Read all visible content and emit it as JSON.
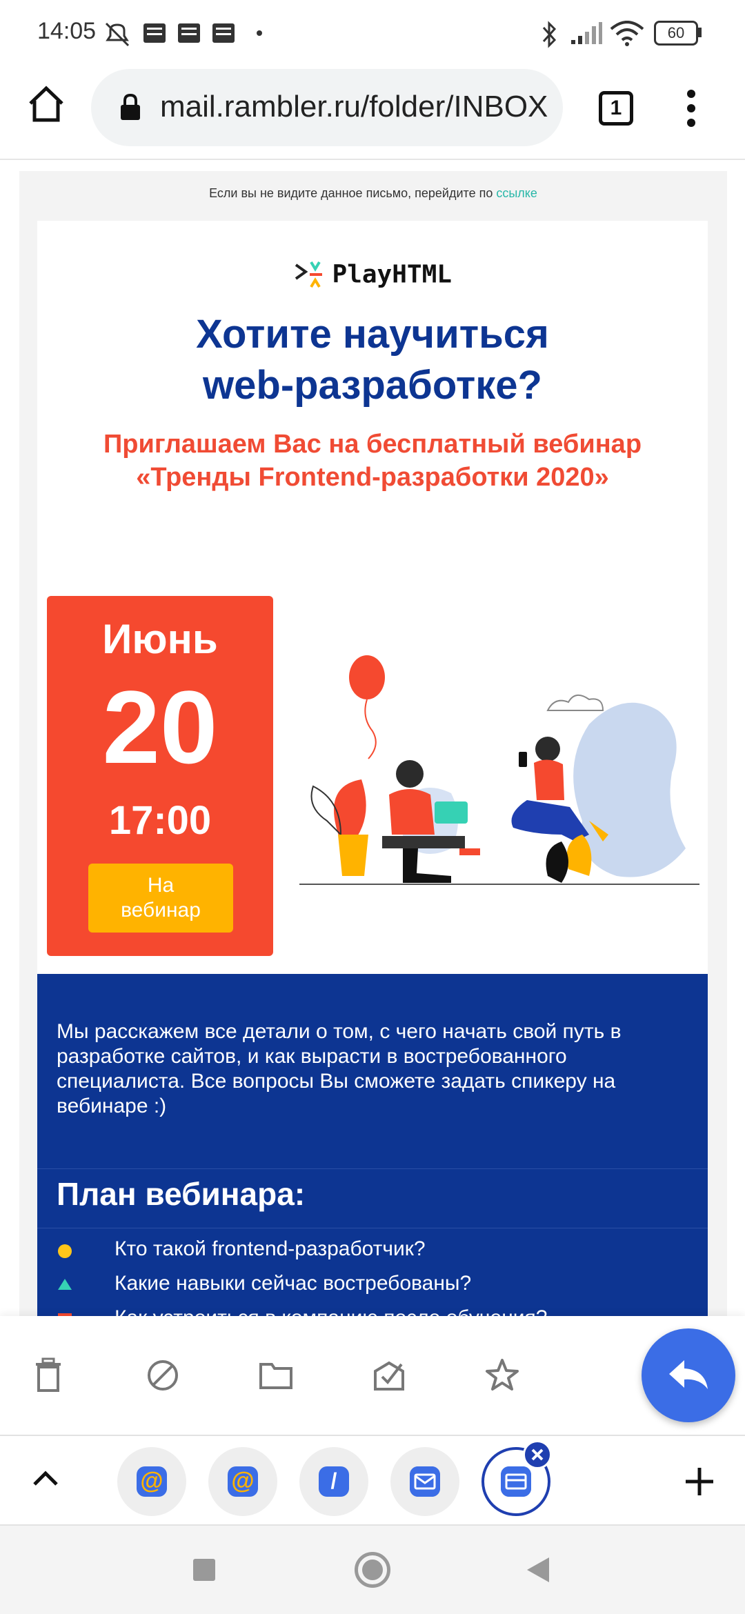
{
  "status_bar": {
    "time": "14:05",
    "battery": "60"
  },
  "browser": {
    "url": "mail.rambler.ru/folder/INBOX",
    "tab_count": "1"
  },
  "email": {
    "preheader_text": "Если вы не видите данное письмо, перейдите по ",
    "preheader_link": "ссылке",
    "logo_text": "PlayHTML",
    "headline_line1": "Хотите научиться",
    "headline_line2": "web-разработке?",
    "subhead_line1": "Приглашаем Вас на бесплатный вебинар",
    "subhead_line2": "«Тренды Frontend-разработки 2020»",
    "date": {
      "month": "Июнь",
      "day": "20",
      "time": "17:00",
      "button_line1": "На",
      "button_line2": "вебинар"
    },
    "intro_text": "Мы расскажем все детали о том, с чего начать свой путь в разработке сайтов, и как вырасти в востребованного специалиста. Все вопросы Вы сможете задать спикеру на вебинаре :)",
    "plan_title": "План вебинара:",
    "plan_items": [
      "Кто такой frontend-разработчик?",
      "Какие навыки сейчас востребованы?",
      "Как устроиться в компанию после обучения?"
    ]
  },
  "toolbar": {
    "icons": [
      "trash-icon",
      "block-icon",
      "folder-icon",
      "mark-read-icon",
      "star-icon",
      "reply-icon"
    ]
  },
  "tabs": {
    "icons": [
      "chevron-up-icon",
      "at-icon",
      "at-icon",
      "slash-icon",
      "mail-icon",
      "mail-icon",
      "close-icon",
      "plus-icon"
    ]
  },
  "colors": {
    "brand_blue": "#0d3592",
    "accent_red": "#f5492f",
    "accent_yellow": "#ffb300",
    "fab_blue": "#3b6de6"
  }
}
